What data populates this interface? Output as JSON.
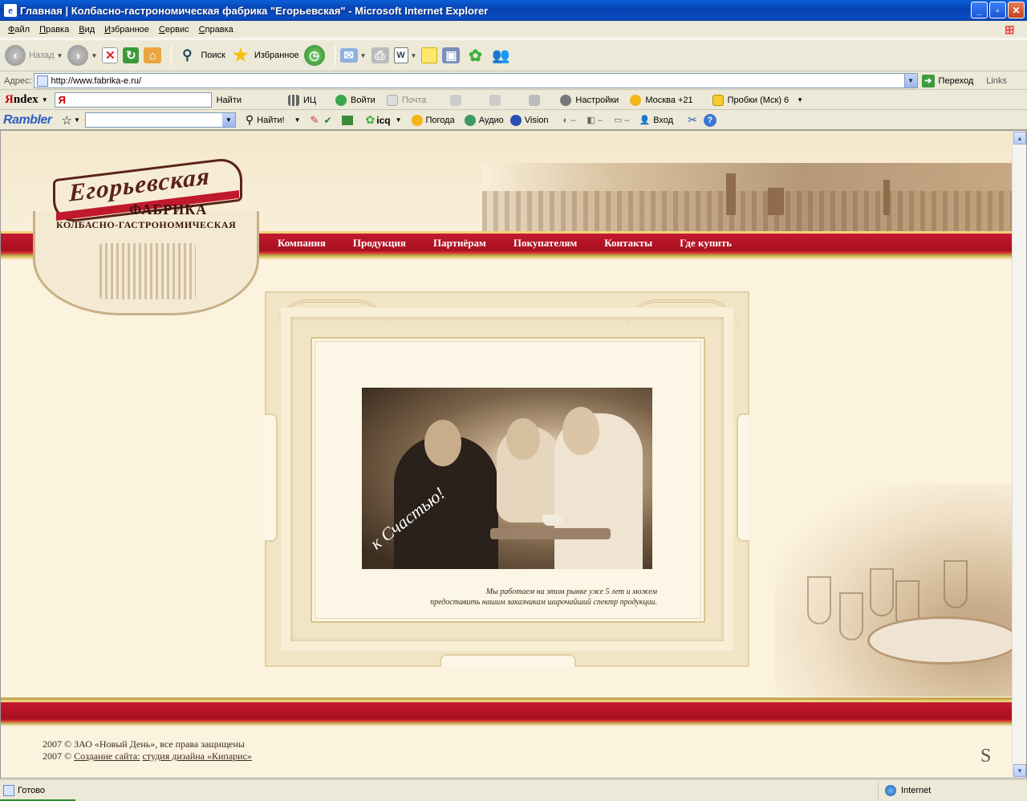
{
  "window": {
    "title": "Главная | Колбасно-гастрономическая фабрика \"Егорьевская\" - Microsoft Internet Explorer",
    "icon": "ie-icon",
    "controls": [
      "minimize",
      "maximize",
      "close"
    ]
  },
  "menu": [
    "Файл",
    "Правка",
    "Вид",
    "Избранное",
    "Сервис",
    "Справка"
  ],
  "toolbar": {
    "back": "Назад",
    "search": "Поиск",
    "favorites": "Избранное"
  },
  "address": {
    "label": "Адрес:",
    "url": "http://www.fabrika-e.ru/",
    "go": "Переход",
    "links": "Links"
  },
  "yandex": {
    "logo_prefix": "Я",
    "logo_rest": "ndex",
    "input_letter": "Я",
    "find": "Найти",
    "ic": "ИЦ",
    "login": "Войти",
    "mail": "Почта",
    "settings": "Настройки",
    "weather": "Москва +21",
    "traffic": "Пробки (Мск) 6"
  },
  "rambler": {
    "logo": "Rambler",
    "find": "Найти!",
    "icq": "icq",
    "weather": "Погода",
    "audio": "Аудио",
    "vision": "Vision",
    "login": "Вход"
  },
  "site": {
    "logo_name": "Егорьевская",
    "logo_sub1": "ФАБРИКА",
    "logo_sub2": "КОЛБАСНО-ГАСТРОНОМИЧЕСКАЯ",
    "nav": [
      "Компания",
      "Продукция",
      "Партнёрам",
      "Покупателям",
      "Контакты",
      "Где купить"
    ],
    "photo_script": "к Счастью!",
    "caption_line1": "Мы работаем на этом рынке уже 5 лет и можем",
    "caption_line2": "предоставить нашим заказчикам широчайший спектр продукции.",
    "copyright_line1": "2007 © ЗАО «Новый День», все права защищены",
    "copyright_line2_prefix": "2007 © ",
    "copyright_link1": "Создание сайта:",
    "copyright_link2": "студия дизайна «Кипарис»",
    "studio_logo": "S"
  },
  "status": {
    "left": "Готово",
    "zone": "Internet"
  }
}
